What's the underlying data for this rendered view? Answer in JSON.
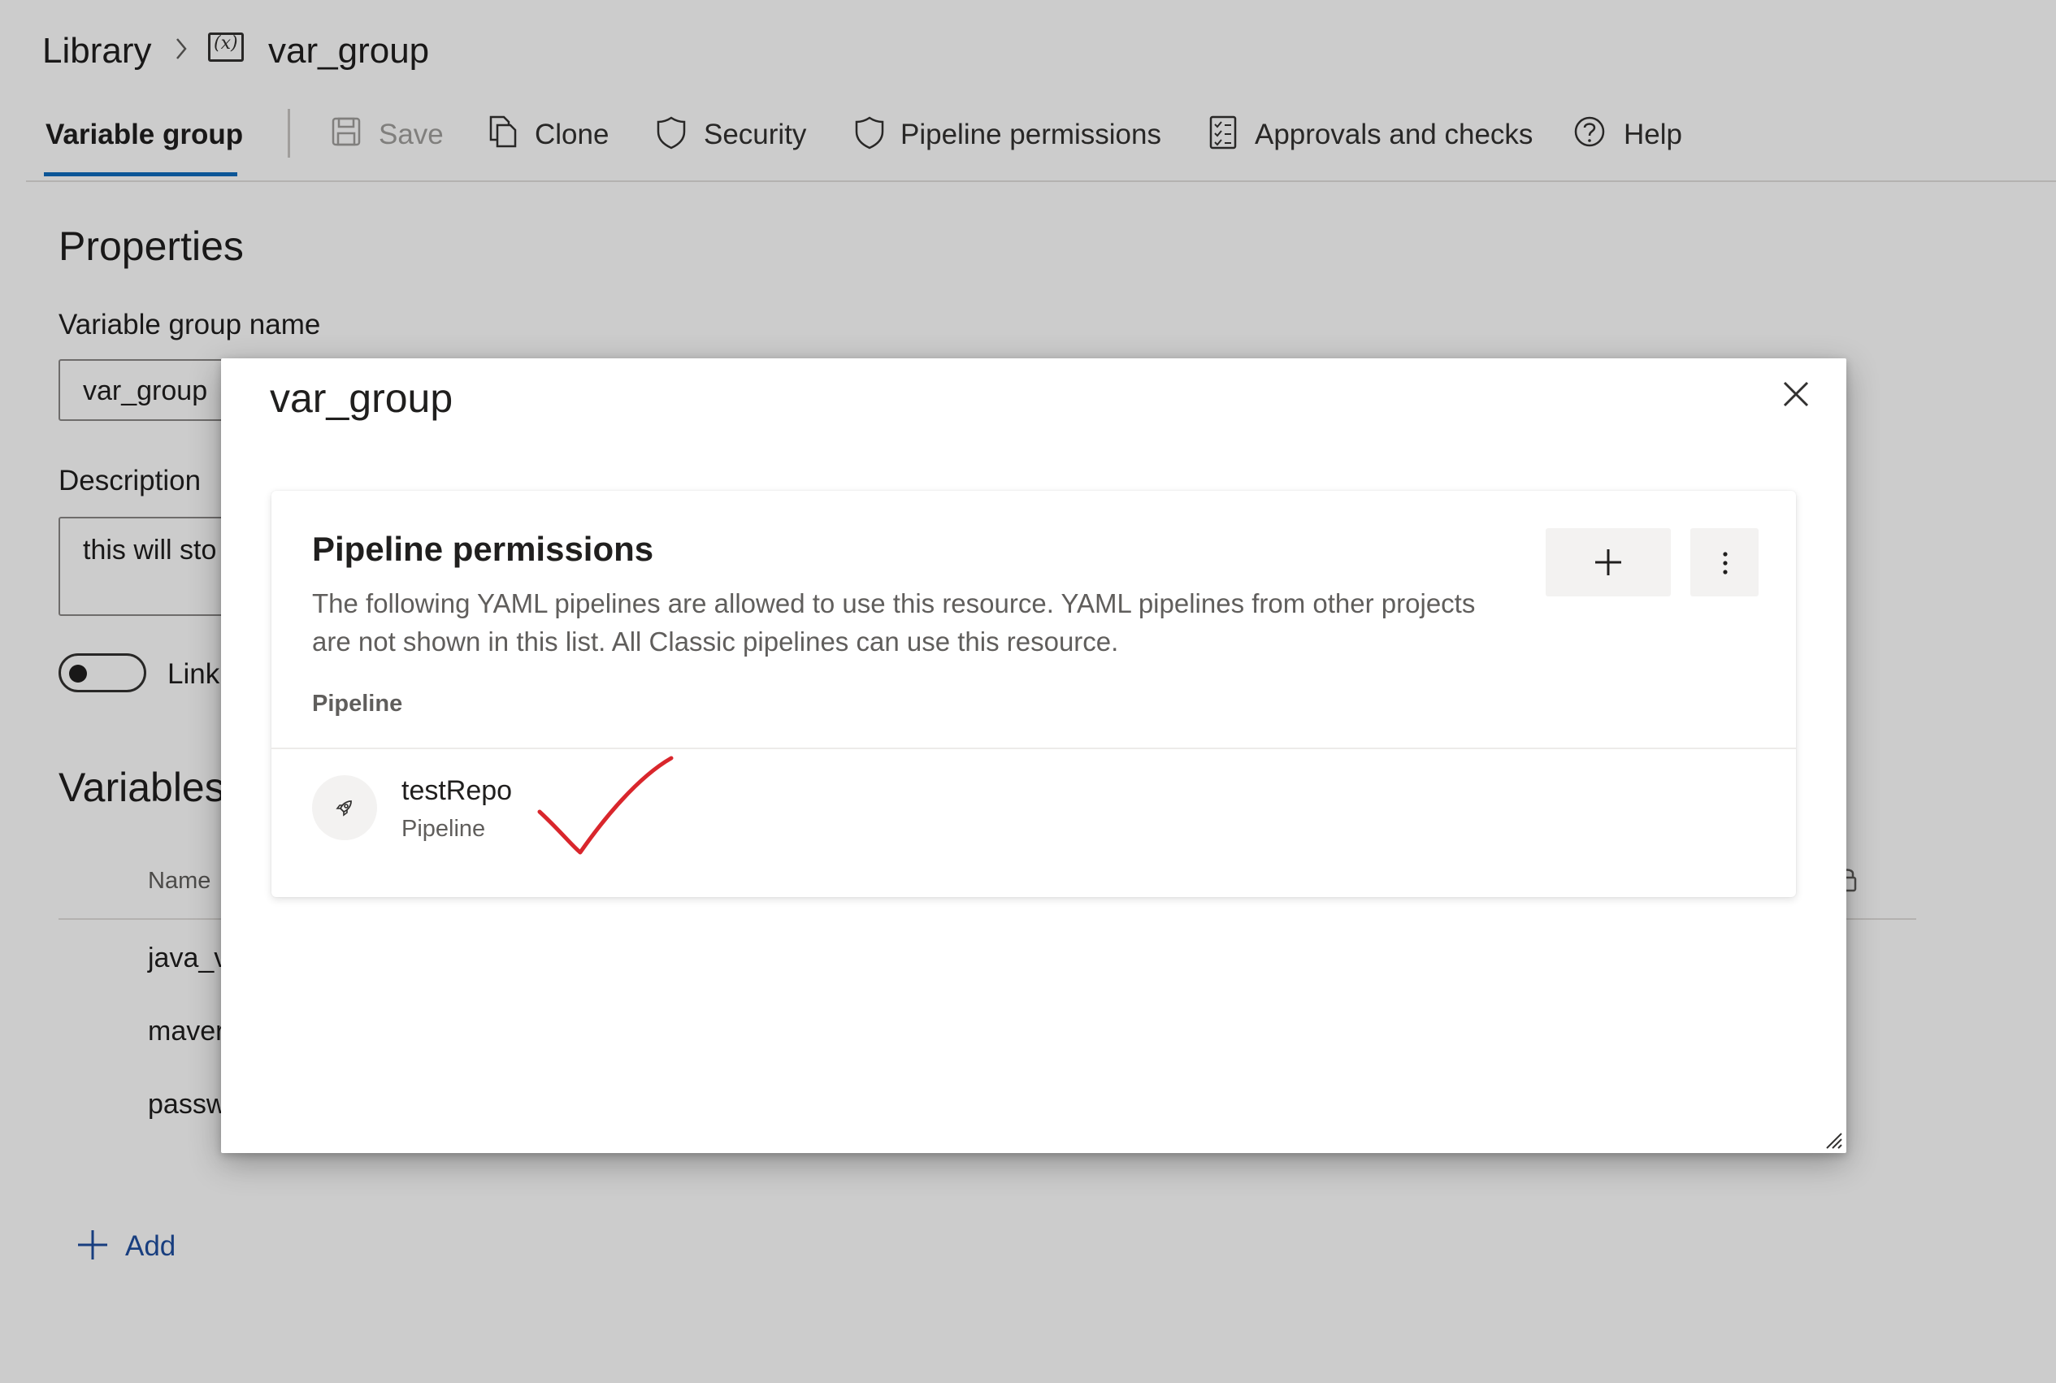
{
  "breadcrumb": {
    "root": "Library",
    "separator": ">",
    "current": "var_group",
    "group_icon_text": "(x)"
  },
  "tabs": {
    "variable_group": "Variable group",
    "save": "Save",
    "clone": "Clone",
    "security": "Security",
    "pipeline_permissions": "Pipeline permissions",
    "approvals": "Approvals and checks",
    "help": "Help"
  },
  "properties": {
    "heading": "Properties",
    "name_label": "Variable group name",
    "name_value": "var_group",
    "description_label": "Description",
    "description_value": "this will sto",
    "link_label": "Link"
  },
  "variables": {
    "heading": "Variables",
    "name_column": "Name",
    "rows": [
      "java_v",
      "maver",
      "passw"
    ],
    "add_label": "Add"
  },
  "dialog": {
    "title": "var_group",
    "card_title": "Pipeline permissions",
    "description_line1": "The following YAML pipelines are allowed to use this resource. YAML pipelines from other projects",
    "description_line2": "are not shown in this list. All Classic pipelines can use this resource.",
    "column_header": "Pipeline",
    "pipelines": [
      {
        "name": "testRepo",
        "type": "Pipeline"
      }
    ],
    "add_button_symbol": "+",
    "more_button_symbol": "⋮"
  },
  "colors": {
    "accent": "#0f6cbd",
    "link": "#1f4e9f",
    "annotation": "#d9262c"
  },
  "icons": [
    "chevron-right-icon",
    "variable-group-icon",
    "save-icon",
    "clone-icon",
    "shield-icon",
    "checklist-icon",
    "help-icon",
    "close-icon",
    "rocket-icon",
    "plus-icon",
    "more-icon",
    "resize-grip-icon"
  ]
}
